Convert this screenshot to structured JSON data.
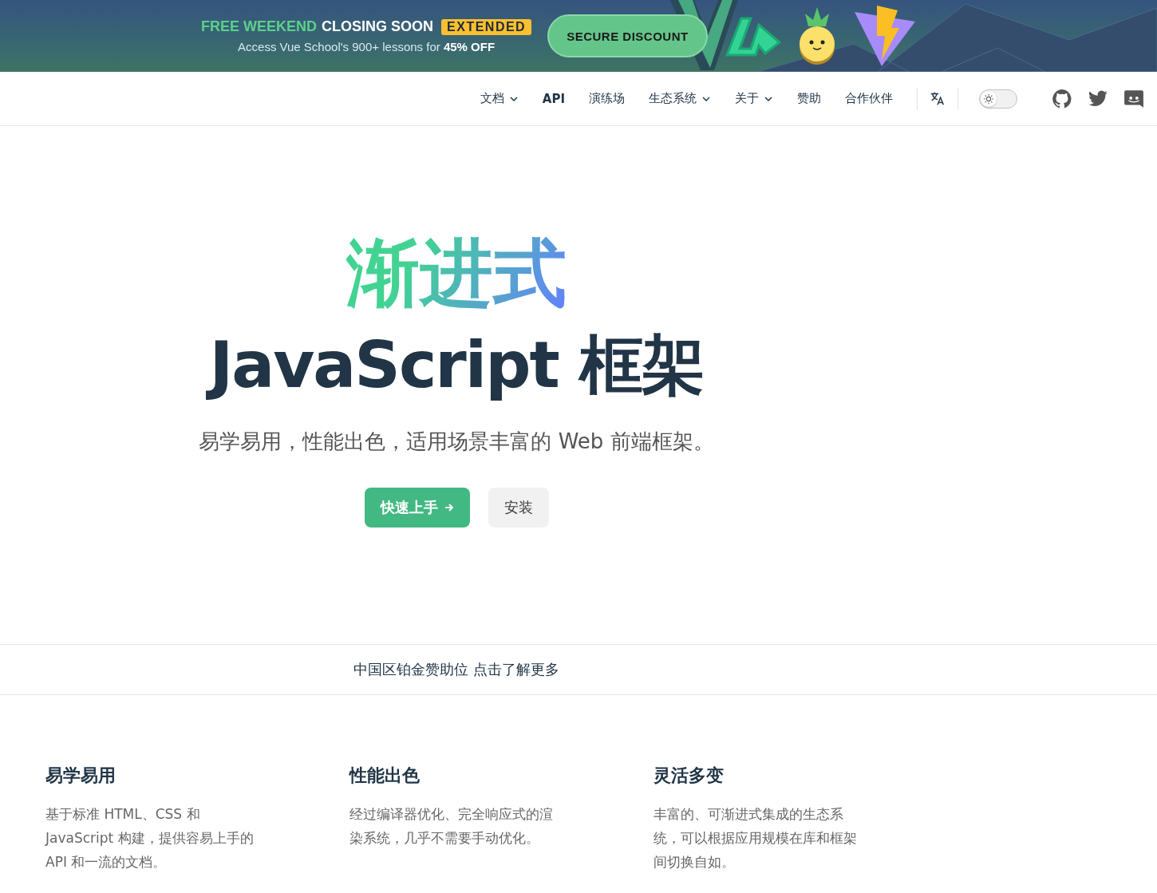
{
  "banner": {
    "title_highlight": "FREE WEEKEND",
    "title_rest": "CLOSING SOON",
    "badge": "EXTENDED",
    "subtitle": "Access Vue School's 900+ lessons for **45% OFF**",
    "button": "SECURE DISCOUNT"
  },
  "nav": {
    "items": [
      {
        "label": "文档",
        "kind": "dropdown"
      },
      {
        "label": "API",
        "kind": "link"
      },
      {
        "label": "演练场",
        "kind": "link"
      },
      {
        "label": "生态系统",
        "kind": "dropdown"
      },
      {
        "label": "关于",
        "kind": "dropdown"
      },
      {
        "label": "赞助",
        "kind": "link"
      },
      {
        "label": "合作伙伴",
        "kind": "link"
      }
    ],
    "theme_toggle": {
      "dark": false
    }
  },
  "hero": {
    "accent": "渐进式",
    "title": "JavaScript 框架",
    "tagline": "易学易用，性能出色，适用场景丰富的 Web 前端框架。",
    "buttons": [
      {
        "label": "快速上手",
        "kind": "primary"
      },
      {
        "label": "安装",
        "kind": "secondary"
      }
    ]
  },
  "sponsor": {
    "text": "中国区铂金赞助位 点击了解更多"
  },
  "features": [
    {
      "title": "易学易用",
      "text": "基于标准 HTML、CSS 和 JavaScript 构建，提供容易上手的 API 和一流的文档。"
    },
    {
      "title": "性能出色",
      "text": "经过编译器优化、完全响应式的渲染系统，几乎不需要手动优化。"
    },
    {
      "title": "灵活多变",
      "text": "丰富的、可渐进式集成的生态系统，可以根据应用规模在库和框架间切换自如。"
    }
  ]
}
